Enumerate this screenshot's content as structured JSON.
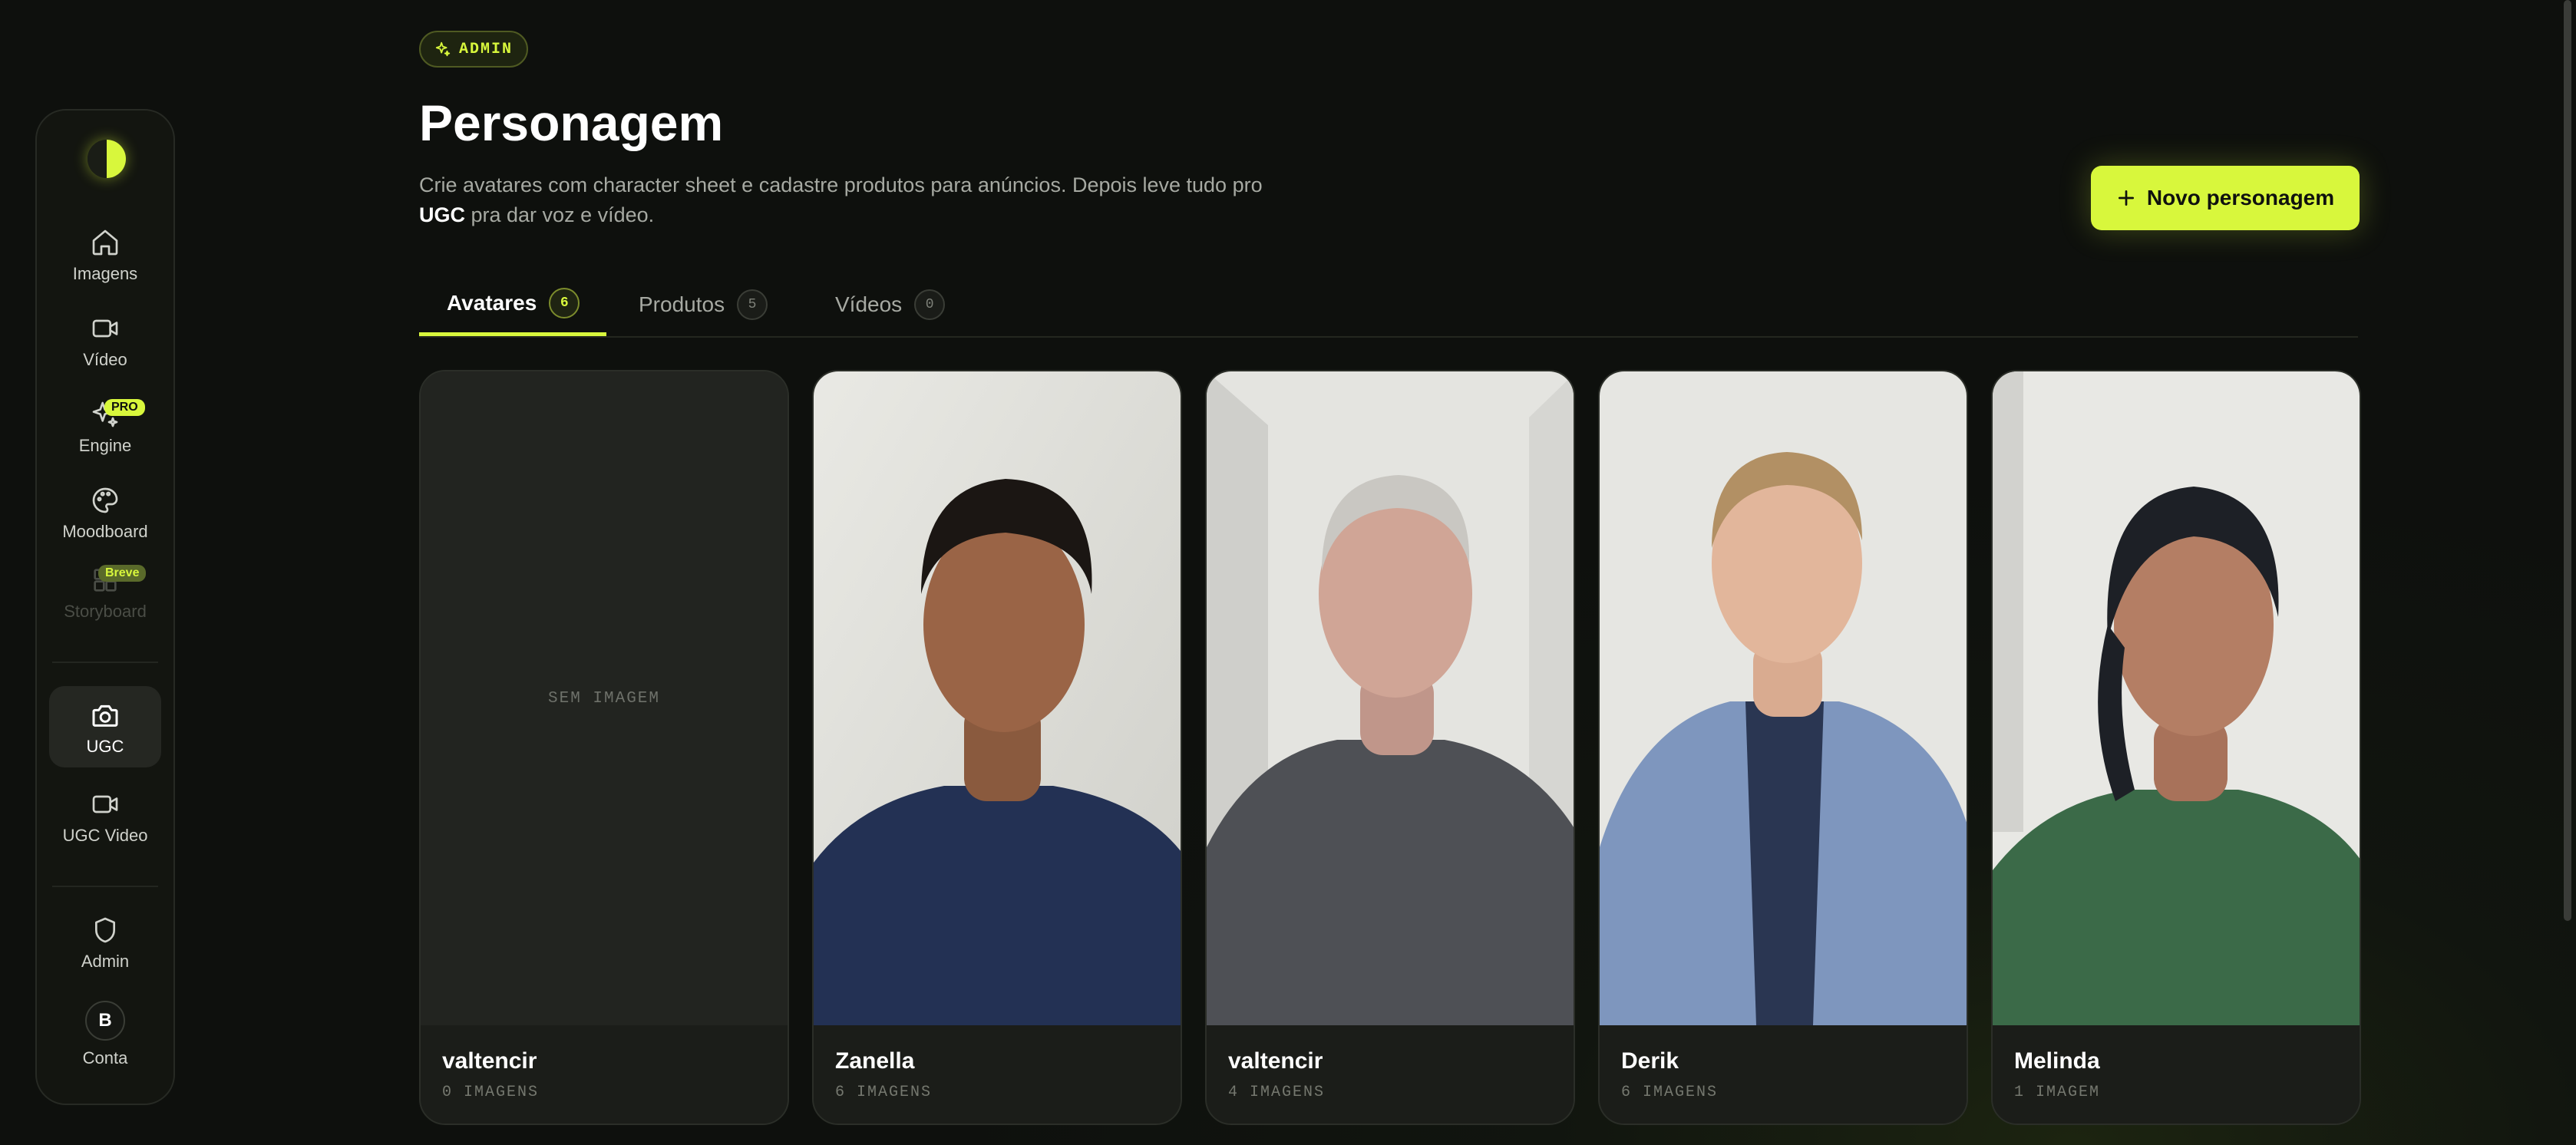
{
  "brand": {
    "accent": "#d8f73c",
    "background": "#0f110e"
  },
  "sidebar": {
    "items": [
      {
        "label": "Imagens",
        "icon": "home-icon"
      },
      {
        "label": "Vídeo",
        "icon": "video-icon"
      },
      {
        "label": "Engine",
        "icon": "sparkle-icon",
        "badge": "PRO"
      },
      {
        "label": "Moodboard",
        "icon": "palette-icon"
      },
      {
        "label": "Storyboard",
        "icon": "grid-icon",
        "badge": "Breve",
        "disabled": true
      },
      {
        "label": "UGC",
        "icon": "camera-icon",
        "active": true
      },
      {
        "label": "UGC Video",
        "icon": "video-icon"
      },
      {
        "label": "Admin",
        "icon": "shield-icon"
      },
      {
        "label": "Conta",
        "icon": "avatar",
        "initial": "B"
      }
    ]
  },
  "header": {
    "tag": "ADMIN",
    "title": "Personagem",
    "description_line1": "Crie avatares com character sheet e cadastre produtos para anúncios. Depois leve tudo pro",
    "description_bold": "UGC",
    "description_line2_rest": " pra dar voz e vídeo.",
    "new_button": "Novo personagem"
  },
  "tabs": [
    {
      "label": "Avatares",
      "count": "6",
      "active": true
    },
    {
      "label": "Produtos",
      "count": "5"
    },
    {
      "label": "Vídeos",
      "count": "0"
    }
  ],
  "cards": [
    {
      "name": "valtencir",
      "images": "0 IMAGENS",
      "placeholder": "SEM IMAGEM"
    },
    {
      "name": "Zanella",
      "images": "6 IMAGENS"
    },
    {
      "name": "valtencir",
      "images": "4 IMAGENS"
    },
    {
      "name": "Derik",
      "images": "6 IMAGENS"
    },
    {
      "name": "Melinda",
      "images": "1 IMAGEM"
    }
  ]
}
